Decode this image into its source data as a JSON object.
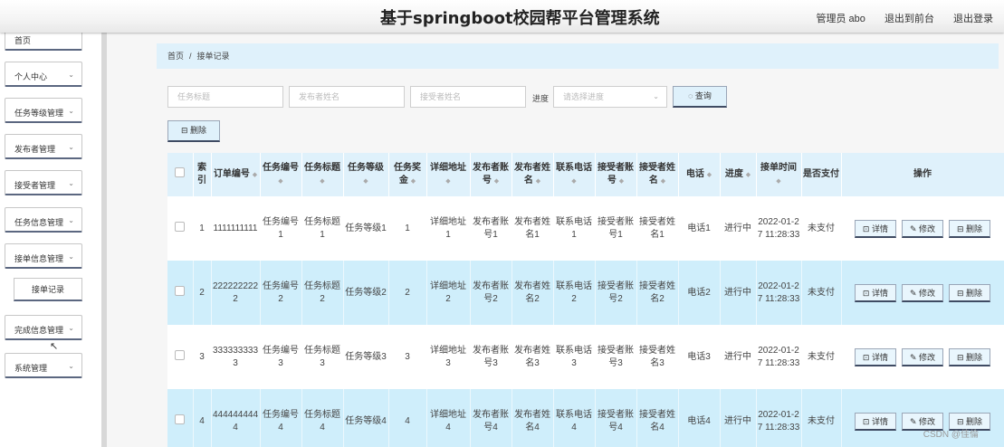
{
  "app": {
    "title": "基于springboot校园帮平台管理系统"
  },
  "top": {
    "admin_label": "管理员 abo",
    "back_to_front": "退出到前台",
    "logout": "退出登录"
  },
  "sidebar": {
    "items": [
      {
        "label": "首页"
      },
      {
        "label": "个人中心"
      },
      {
        "label": "任务等级管理"
      },
      {
        "label": "发布者管理"
      },
      {
        "label": "接受者管理"
      },
      {
        "label": "任务信息管理"
      },
      {
        "label": "接单信息管理"
      },
      {
        "label": "接单记录"
      },
      {
        "label": "完成信息管理"
      },
      {
        "label": "系统管理"
      }
    ]
  },
  "breadcrumb": {
    "home": "首页",
    "sep": "/",
    "current": "接单记录"
  },
  "search": {
    "task_title_ph": "任务标题",
    "publisher_name_ph": "发布者姓名",
    "receiver_name_ph": "接受者姓名",
    "progress_label": "进度",
    "progress_ph": "请选择进度",
    "query_btn": "◌ 查询"
  },
  "toolbar": {
    "delete_btn": "⊟ 删除"
  },
  "table": {
    "headers": [
      "索引",
      "订单编号",
      "任务编号",
      "任务标题",
      "任务等级",
      "任务奖金",
      "详细地址",
      "发布者账号",
      "发布者姓名",
      "联系电话",
      "接受者账号",
      "接受者姓名",
      "电话",
      "进度",
      "接单时间",
      "是否支付",
      "操作"
    ],
    "ops": {
      "detail": "⊡ 详情",
      "edit": "✎ 修改",
      "delete": "⊟ 删除"
    },
    "rows": [
      {
        "idx": "1",
        "order": "1111111111",
        "task_no": "任务编号1",
        "task_title": "任务标题1",
        "task_level": "任务等级1",
        "reward": "1",
        "address": "详细地址1",
        "pub_acct": "发布者账号1",
        "pub_name": "发布者姓名1",
        "contact": "联系电话1",
        "rec_acct": "接受者账号1",
        "rec_name": "接受者姓名1",
        "phone": "电话1",
        "progress": "进行中",
        "time": "2022-01-27 11:28:33",
        "paid": "未支付"
      },
      {
        "idx": "2",
        "order": "2222222222",
        "task_no": "任务编号2",
        "task_title": "任务标题2",
        "task_level": "任务等级2",
        "reward": "2",
        "address": "详细地址2",
        "pub_acct": "发布者账号2",
        "pub_name": "发布者姓名2",
        "contact": "联系电话2",
        "rec_acct": "接受者账号2",
        "rec_name": "接受者姓名2",
        "phone": "电话2",
        "progress": "进行中",
        "time": "2022-01-27 11:28:33",
        "paid": "未支付"
      },
      {
        "idx": "3",
        "order": "3333333333",
        "task_no": "任务编号3",
        "task_title": "任务标题3",
        "task_level": "任务等级3",
        "reward": "3",
        "address": "详细地址3",
        "pub_acct": "发布者账号3",
        "pub_name": "发布者姓名3",
        "contact": "联系电话3",
        "rec_acct": "接受者账号3",
        "rec_name": "接受者姓名3",
        "phone": "电话3",
        "progress": "进行中",
        "time": "2022-01-27 11:28:33",
        "paid": "未支付"
      },
      {
        "idx": "4",
        "order": "4444444444",
        "task_no": "任务编号4",
        "task_title": "任务标题4",
        "task_level": "任务等级4",
        "reward": "4",
        "address": "详细地址4",
        "pub_acct": "发布者账号4",
        "pub_name": "发布者姓名4",
        "contact": "联系电话4",
        "rec_acct": "接受者账号4",
        "rec_name": "接受者姓名4",
        "phone": "电话4",
        "progress": "进行中",
        "time": "2022-01-27 11:28:33",
        "paid": "未支付"
      }
    ]
  },
  "watermark": "CSDN @佳倫"
}
